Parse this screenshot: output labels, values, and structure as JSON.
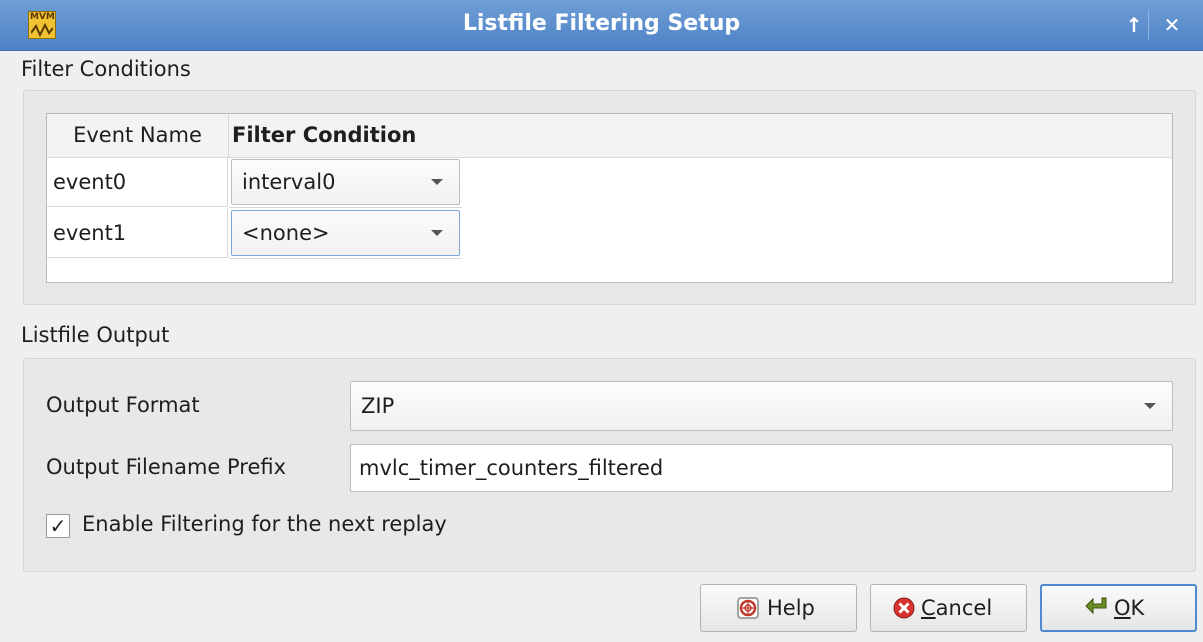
{
  "window": {
    "title": "Listfile Filtering Setup"
  },
  "titlebar": {
    "icons": [
      "app-icon",
      "keep-above-icon",
      "close-icon"
    ],
    "up_glyph": "↑",
    "close_glyph": "✕"
  },
  "filter_conditions": {
    "group_title": "Filter Conditions",
    "columns": [
      "Event Name",
      "Filter Condition"
    ],
    "rows": [
      {
        "event": "event0",
        "condition": "interval0"
      },
      {
        "event": "event1",
        "condition": "<none>"
      }
    ]
  },
  "listfile_output": {
    "group_title": "Listfile Output",
    "format_label": "Output Format",
    "format_value": "ZIP",
    "prefix_label": "Output Filename Prefix",
    "prefix_value": "mvlc_timer_counters_filtered",
    "enable_label": "Enable Filtering for the next replay",
    "enable_checked": true,
    "check_glyph": "✓"
  },
  "buttons": {
    "help": "Help",
    "cancel_mnemonic": "C",
    "cancel_rest": "ancel",
    "ok_mnemonic": "O",
    "ok_rest": "K"
  },
  "colors": {
    "titlebar": "#5a8ccc",
    "default_button_border": "#4f8ad1",
    "cancel_icon": "#d93030",
    "ok_icon": "#6b8e23"
  }
}
